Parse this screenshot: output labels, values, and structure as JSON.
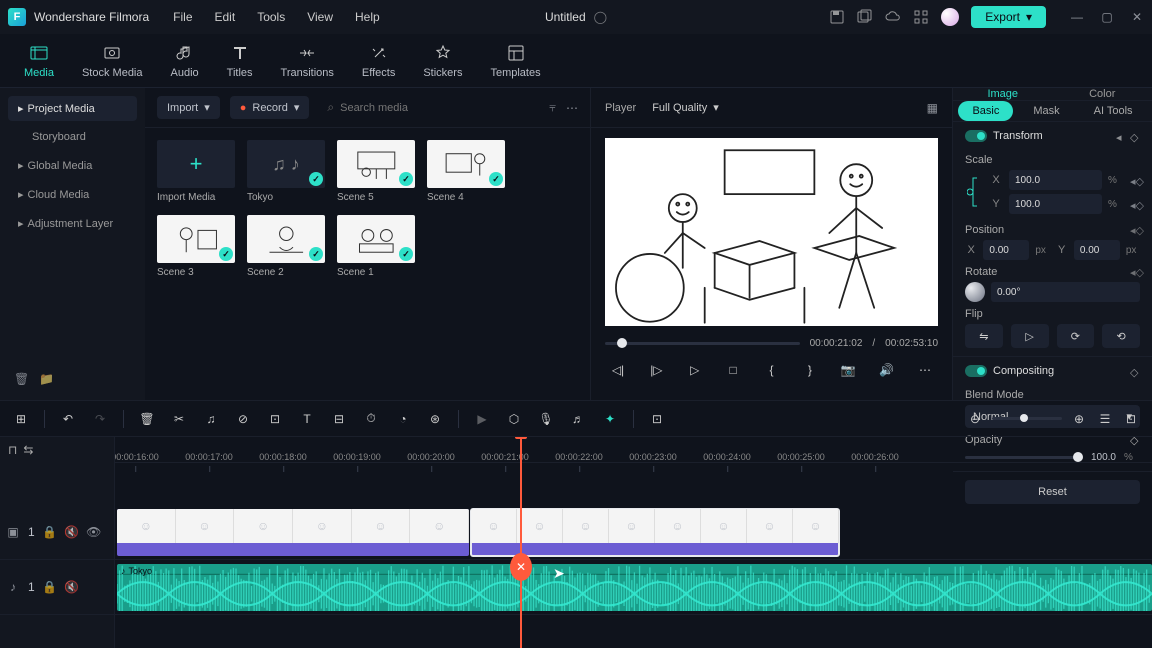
{
  "app": {
    "name": "Wondershare Filmora",
    "title": "Untitled",
    "export": "Export"
  },
  "menu": [
    "File",
    "Edit",
    "Tools",
    "View",
    "Help"
  ],
  "mainTabs": [
    {
      "label": "Media",
      "icon": "media-icon",
      "active": true
    },
    {
      "label": "Stock Media",
      "icon": "stock-icon"
    },
    {
      "label": "Audio",
      "icon": "audio-icon"
    },
    {
      "label": "Titles",
      "icon": "titles-icon"
    },
    {
      "label": "Transitions",
      "icon": "transitions-icon"
    },
    {
      "label": "Effects",
      "icon": "effects-icon"
    },
    {
      "label": "Stickers",
      "icon": "stickers-icon"
    },
    {
      "label": "Templates",
      "icon": "templates-icon"
    }
  ],
  "leftPanel": {
    "primary": "Project Media",
    "items": [
      "Storyboard",
      "Global Media",
      "Cloud Media",
      "Adjustment Layer"
    ]
  },
  "mediaToolbar": {
    "import": "Import",
    "record": "Record",
    "searchPlaceholder": "Search media"
  },
  "mediaItems": [
    {
      "name": "Import Media",
      "kind": "import"
    },
    {
      "name": "Tokyo",
      "kind": "audio",
      "checked": true
    },
    {
      "name": "Scene 5",
      "kind": "scene",
      "checked": true
    },
    {
      "name": "Scene 4",
      "kind": "scene",
      "checked": true
    },
    {
      "name": "Scene 3",
      "kind": "scene",
      "checked": true
    },
    {
      "name": "Scene 2",
      "kind": "scene",
      "checked": true
    },
    {
      "name": "Scene 1",
      "kind": "scene",
      "checked": true
    }
  ],
  "player": {
    "label": "Player",
    "quality": "Full Quality",
    "current": "00:00:21:02",
    "total": "00:02:53:10",
    "sep": "/"
  },
  "props": {
    "tabs": [
      "Image",
      "Color"
    ],
    "subtabs": [
      "Basic",
      "Mask",
      "AI Tools"
    ],
    "transform": {
      "title": "Transform",
      "scaleLabel": "Scale",
      "scaleX": "100.0",
      "scaleY": "100.0",
      "scaleUnit": "%",
      "positionLabel": "Position",
      "posX": "0.00",
      "posY": "0.00",
      "posUnit": "px",
      "axisX": "X",
      "axisY": "Y",
      "rotateLabel": "Rotate",
      "rotate": "0.00°",
      "flipLabel": "Flip"
    },
    "compositing": {
      "title": "Compositing",
      "blendLabel": "Blend Mode",
      "blendValue": "Normal",
      "opacityLabel": "Opacity",
      "opacityValue": "100.0",
      "opacityUnit": "%"
    },
    "reset": "Reset"
  },
  "timeline": {
    "ruler": [
      "00:00:16:00",
      "00:00:17:00",
      "00:00:18:00",
      "00:00:19:00",
      "00:00:20:00",
      "00:00:21:00",
      "00:00:22:00",
      "00:00:23:00",
      "00:00:24:00",
      "00:00:25:00",
      "00:00:26:00"
    ],
    "audioClipLabel": "Tokyo",
    "videoTrackName": "1",
    "audioTrackName": "1"
  }
}
